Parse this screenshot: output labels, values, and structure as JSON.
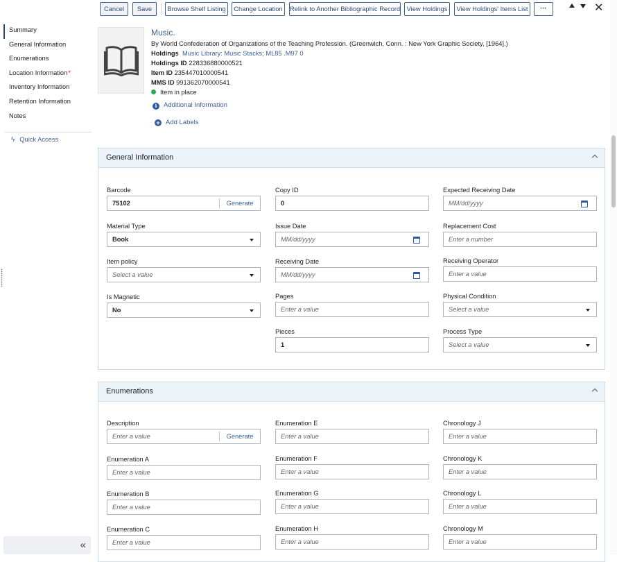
{
  "toolbar": {
    "cancel": "Cancel",
    "save": "Save",
    "browse_shelf": "Browse Shelf Listing",
    "change_location": "Change Location",
    "relink": "Relink to Another Bibliographic Record",
    "view_holdings": "View Holdings",
    "view_items": "View Holdings' Items List",
    "more": "•••",
    "close": "✕"
  },
  "sidebar": {
    "items": [
      {
        "label": "Summary"
      },
      {
        "label": "General Information"
      },
      {
        "label": "Enumerations"
      },
      {
        "label": "Location Information",
        "required_mark": "*"
      },
      {
        "label": "Inventory Information"
      },
      {
        "label": "Retention Information"
      },
      {
        "label": "Notes"
      }
    ],
    "quick_access": "Quick Access",
    "collapse": "«"
  },
  "record": {
    "title": "Music.",
    "author_line": "By World Confederation of Organizations of the Teaching Profession. (Greenwich, Conn. : New York Graphic Society, [1964].)",
    "holdings_label": "Holdings",
    "holdings_value": "Music Library: Music Stacks; ML85 .M97 0",
    "holdings_id_label": "Holdings ID",
    "holdings_id": "228336880000521",
    "item_id_label": "Item ID",
    "item_id": "235447010000541",
    "mms_id_label": "MMS ID",
    "mms_id": "991362070000541",
    "status": "Item in place",
    "status_color": "#2ea84b",
    "additional_info": "Additional Information",
    "add_labels": "Add Labels"
  },
  "general": {
    "title": "General Information",
    "barcode": {
      "label": "Barcode",
      "value": "75102",
      "action": "Generate"
    },
    "copy_id": {
      "label": "Copy ID",
      "value": "0"
    },
    "expected_receiving_date": {
      "label": "Expected Receiving Date",
      "placeholder": "MM/dd/yyyy"
    },
    "material_type": {
      "label": "Material Type",
      "value": "Book"
    },
    "issue_date": {
      "label": "Issue Date",
      "placeholder": "MM/dd/yyyy"
    },
    "replacement_cost": {
      "label": "Replacement Cost",
      "placeholder": "Enter a number"
    },
    "item_policy": {
      "label": "Item policy",
      "placeholder": "Select a value"
    },
    "receiving_date": {
      "label": "Receiving Date",
      "placeholder": "MM/dd/yyyy"
    },
    "receiving_operator": {
      "label": "Receiving Operator",
      "placeholder": "Enter a value"
    },
    "is_magnetic": {
      "label": "Is Magnetic",
      "value": "No"
    },
    "pages": {
      "label": "Pages",
      "placeholder": "Enter a value"
    },
    "physical_condition": {
      "label": "Physical Condition",
      "placeholder": "Select a value"
    },
    "pieces": {
      "label": "Pieces",
      "value": "1"
    },
    "process_type": {
      "label": "Process Type",
      "placeholder": "Select a value"
    }
  },
  "enumerations": {
    "title": "Enumerations",
    "description": {
      "label": "Description",
      "placeholder": "Enter a value",
      "action": "Generate"
    },
    "enum_e": {
      "label": "Enumeration E",
      "placeholder": "Enter a value"
    },
    "chron_j": {
      "label": "Chronology J",
      "placeholder": "Enter a value"
    },
    "enum_a": {
      "label": "Enumeration A",
      "placeholder": "Enter a value"
    },
    "enum_f": {
      "label": "Enumeration F",
      "placeholder": "Enter a value"
    },
    "chron_k": {
      "label": "Chronology K",
      "placeholder": "Enter a value"
    },
    "enum_b": {
      "label": "Enumeration B",
      "placeholder": "Enter a value"
    },
    "enum_g": {
      "label": "Enumeration G",
      "placeholder": "Enter a value"
    },
    "chron_l": {
      "label": "Chronology L",
      "placeholder": "Enter a value"
    },
    "enum_c": {
      "label": "Enumeration C",
      "placeholder": "Enter a value"
    },
    "enum_h": {
      "label": "Enumeration H",
      "placeholder": "Enter a value"
    },
    "chron_m": {
      "label": "Chronology M",
      "placeholder": "Enter a value"
    }
  }
}
